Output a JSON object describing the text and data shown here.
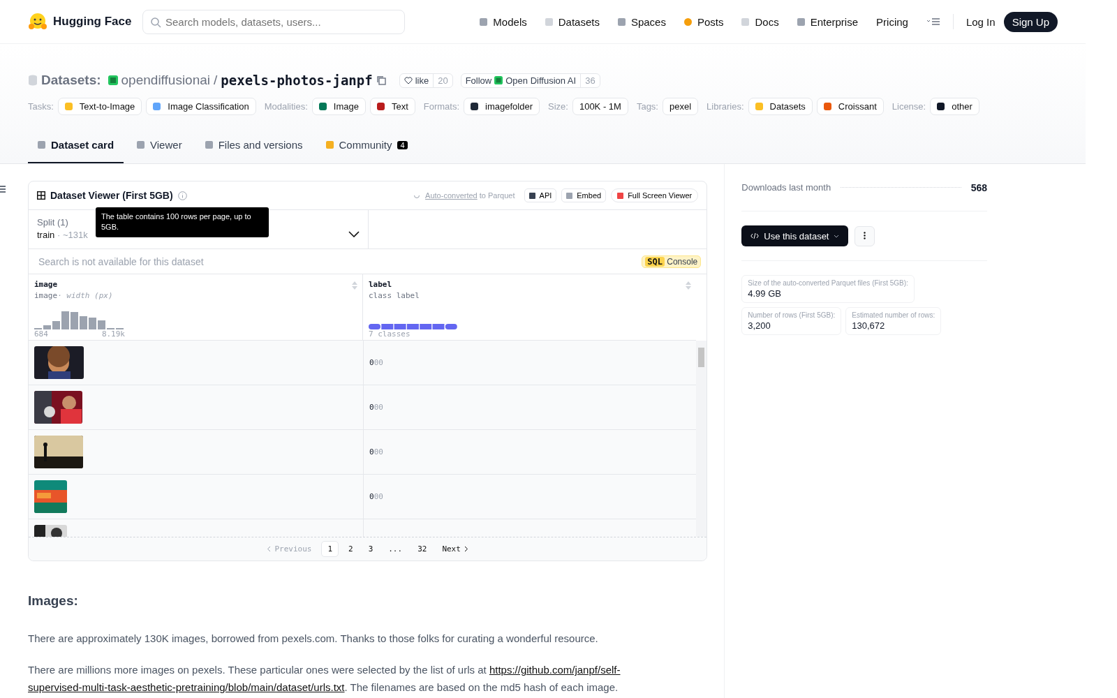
{
  "nav": {
    "brand": "Hugging Face",
    "search_placeholder": "Search models, datasets, users...",
    "links": [
      {
        "label": "Models",
        "kind": "models"
      },
      {
        "label": "Datasets",
        "kind": "datasets"
      },
      {
        "label": "Spaces",
        "kind": "spaces"
      },
      {
        "label": "Posts",
        "kind": "posts"
      },
      {
        "label": "Docs",
        "kind": "docs"
      },
      {
        "label": "Enterprise",
        "kind": "enterprise"
      },
      {
        "label": "Pricing",
        "kind": "plain"
      }
    ],
    "login": "Log In",
    "signup": "Sign Up"
  },
  "header": {
    "section": "Datasets:",
    "owner": "opendiffusionai",
    "separator": "/",
    "name": "pexels-photos-janpf",
    "like": {
      "label": "like",
      "count": "20"
    },
    "follow": {
      "label": "Follow",
      "org": "Open Diffusion AI",
      "count": "36"
    },
    "tag_groups": [
      {
        "label": "Tasks:",
        "tags": [
          {
            "text": "Text-to-Image",
            "kind": "task-text"
          },
          {
            "text": "Image Classification",
            "kind": "task-image"
          }
        ]
      },
      {
        "label": "Modalities:",
        "tags": [
          {
            "text": "Image",
            "kind": "modality-image"
          },
          {
            "text": "Text",
            "kind": "modality-text"
          }
        ]
      },
      {
        "label": "Formats:",
        "tags": [
          {
            "text": "imagefolder",
            "kind": "format"
          }
        ]
      },
      {
        "label": "Size:",
        "tags": [
          {
            "text": "100K - 1M",
            "kind": "plain"
          }
        ]
      },
      {
        "label": "Tags:",
        "tags": [
          {
            "text": "pexel",
            "kind": "plain"
          }
        ]
      },
      {
        "label": "Libraries:",
        "tags": [
          {
            "text": "Datasets",
            "kind": "library-hf"
          },
          {
            "text": "Croissant",
            "kind": "library-croissant"
          }
        ]
      },
      {
        "label": "License:",
        "tags": [
          {
            "text": "other",
            "kind": "license"
          }
        ]
      }
    ]
  },
  "tabs": [
    {
      "label": "Dataset card",
      "selected": true,
      "kind": "card"
    },
    {
      "label": "Viewer",
      "selected": false,
      "kind": "viewer"
    },
    {
      "label": "Files and versions",
      "selected": false,
      "kind": "files"
    },
    {
      "label": "Community",
      "selected": false,
      "kind": "community",
      "badge": "4"
    }
  ],
  "viewer": {
    "title": "Dataset Viewer (First 5GB)",
    "tooltip": "The table contains 100 rows per page, up to 5GB.",
    "auto_link": "Auto-converted",
    "auto_text": "to Parquet",
    "buttons": [
      {
        "label": "API",
        "kind": "api"
      },
      {
        "label": "Embed",
        "kind": "embed"
      },
      {
        "label": "Full Screen Viewer",
        "kind": "fullscreen"
      }
    ],
    "split": {
      "label": "Split (1)",
      "name": "train",
      "dot": "·",
      "rows": "~131k"
    },
    "search_placeholder": "Search is not available for this dataset",
    "sql": {
      "tag": "SQL",
      "label": "Console"
    },
    "columns": [
      {
        "name": "image",
        "type": "image",
        "subtype": "· width (px)",
        "min": "684",
        "max": "8.19k"
      },
      {
        "name": "label",
        "type": "class label",
        "kind": "class",
        "summary": "7 classes"
      }
    ],
    "rows": [
      {
        "label": "0",
        "label_name": "00"
      },
      {
        "label": "0",
        "label_name": "00"
      },
      {
        "label": "0",
        "label_name": "00"
      },
      {
        "label": "0",
        "label_name": "00"
      },
      {}
    ],
    "pagination": {
      "previous": "Previous",
      "next": "Next",
      "pages": [
        {
          "label": "1",
          "selected": true
        },
        {
          "label": "2",
          "selected": false
        },
        {
          "label": "3",
          "selected": false
        },
        {
          "label": "...",
          "selected": false
        },
        {
          "label": "32",
          "selected": false
        }
      ]
    }
  },
  "card": {
    "heading": "Images:",
    "paragraphs": [
      {
        "text": "There are approximately 130K images, borrowed from pexels.com. Thanks to those folks for curating a wonderful resource."
      },
      {
        "text": "There are millions more images on pexels. These particular ones were selected by the list of urls at ",
        "link": "https://github.com/janpf/self-",
        "link_rest": "supervised-multi-task-aesthetic-pretraining/blob/main/dataset/urls.txt",
        "after": ". The filenames are based on the md5 hash of each image."
      }
    ]
  },
  "sidebar": {
    "downloads_label": "Downloads last month",
    "downloads": "568",
    "use_button": "Use this dataset",
    "stats": [
      {
        "label": "Size of the auto-converted Parquet files (First 5GB):",
        "value": "4.99 GB"
      },
      {
        "label": "Number of rows (First 5GB):",
        "value": "3,200"
      },
      {
        "label": "Estimated number of rows:",
        "value": "130,672"
      }
    ]
  }
}
